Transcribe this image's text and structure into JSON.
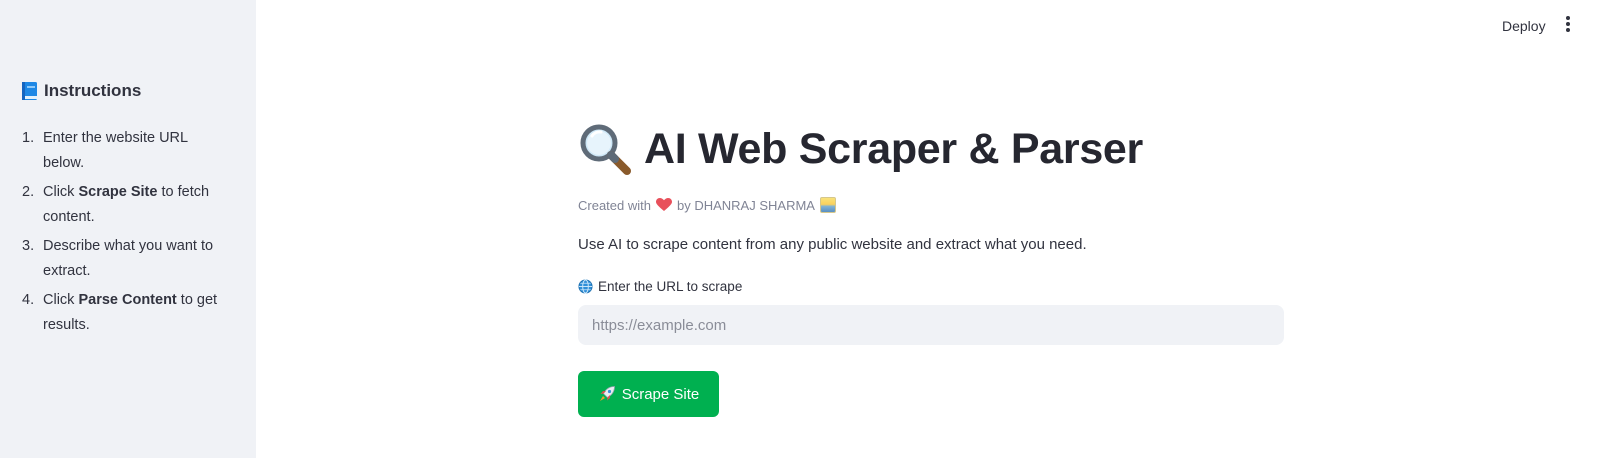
{
  "header": {
    "deploy_label": "Deploy",
    "menu_icon": "vertical-ellipsis-icon"
  },
  "sidebar": {
    "title": "Instructions",
    "title_icon": "blue-book-icon",
    "steps": [
      {
        "num": "1.",
        "before": "Enter the website URL below.",
        "bold": "",
        "after": ""
      },
      {
        "num": "2.",
        "before": "Click ",
        "bold": "Scrape Site",
        "after": " to fetch content."
      },
      {
        "num": "3.",
        "before": "Describe what you want to extract.",
        "bold": "",
        "after": ""
      },
      {
        "num": "4.",
        "before": "Click ",
        "bold": "Parse Content",
        "after": " to get results."
      }
    ]
  },
  "main": {
    "title": "AI Web Scraper & Parser",
    "title_icon": "magnifying-glass-icon",
    "credit_prefix": "Created with",
    "credit_suffix": "by DHANRAJ SHARMA",
    "description": "Use AI to scrape content from any public website and extract what you need.",
    "url_label": "Enter the URL to scrape",
    "url_placeholder": "https://example.com",
    "url_value": "",
    "scrape_button_label": "Scrape Site"
  },
  "colors": {
    "sidebar_bg": "#f0f2f6",
    "primary_button": "#00b050",
    "text": "#31333f",
    "muted_text": "#808495"
  }
}
